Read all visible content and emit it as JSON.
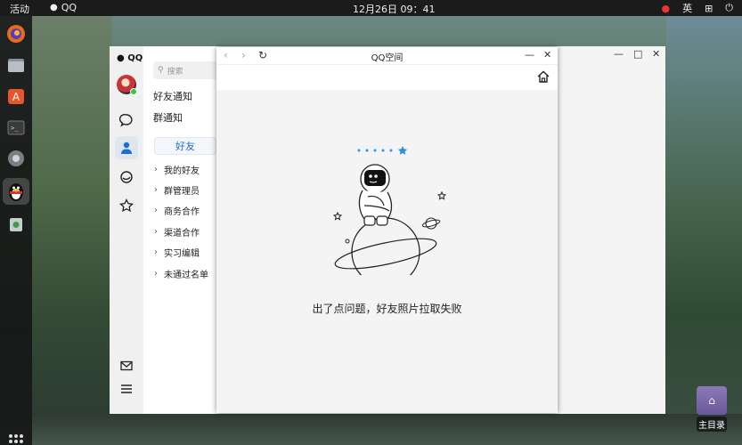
{
  "topbar": {
    "activities": "活动",
    "app_name": "QQ",
    "clock": "12月26日  09：41",
    "ime": "英"
  },
  "dock": {
    "items": [
      "firefox",
      "files",
      "software-center",
      "terminal",
      "settings",
      "qq",
      "trash"
    ]
  },
  "desktop": {
    "home_folder_label": "主目录"
  },
  "qq": {
    "logo": "QQ",
    "search_placeholder": "搜索",
    "friend_notice": "好友通知",
    "group_notice": "群通知",
    "tab_friends": "好友",
    "groups": [
      "我的好友",
      "群管理员",
      "商务合作",
      "渠道合作",
      "实习编辑",
      "未通过名单"
    ],
    "window_controls": [
      "—",
      "□",
      "✕"
    ]
  },
  "space": {
    "title": "QQ空间",
    "error_message": "出了点问题，好友照片拉取失败",
    "nav": {
      "back": "‹",
      "forward": "›",
      "refresh": "↻"
    },
    "window_controls": [
      "—",
      "✕"
    ]
  }
}
